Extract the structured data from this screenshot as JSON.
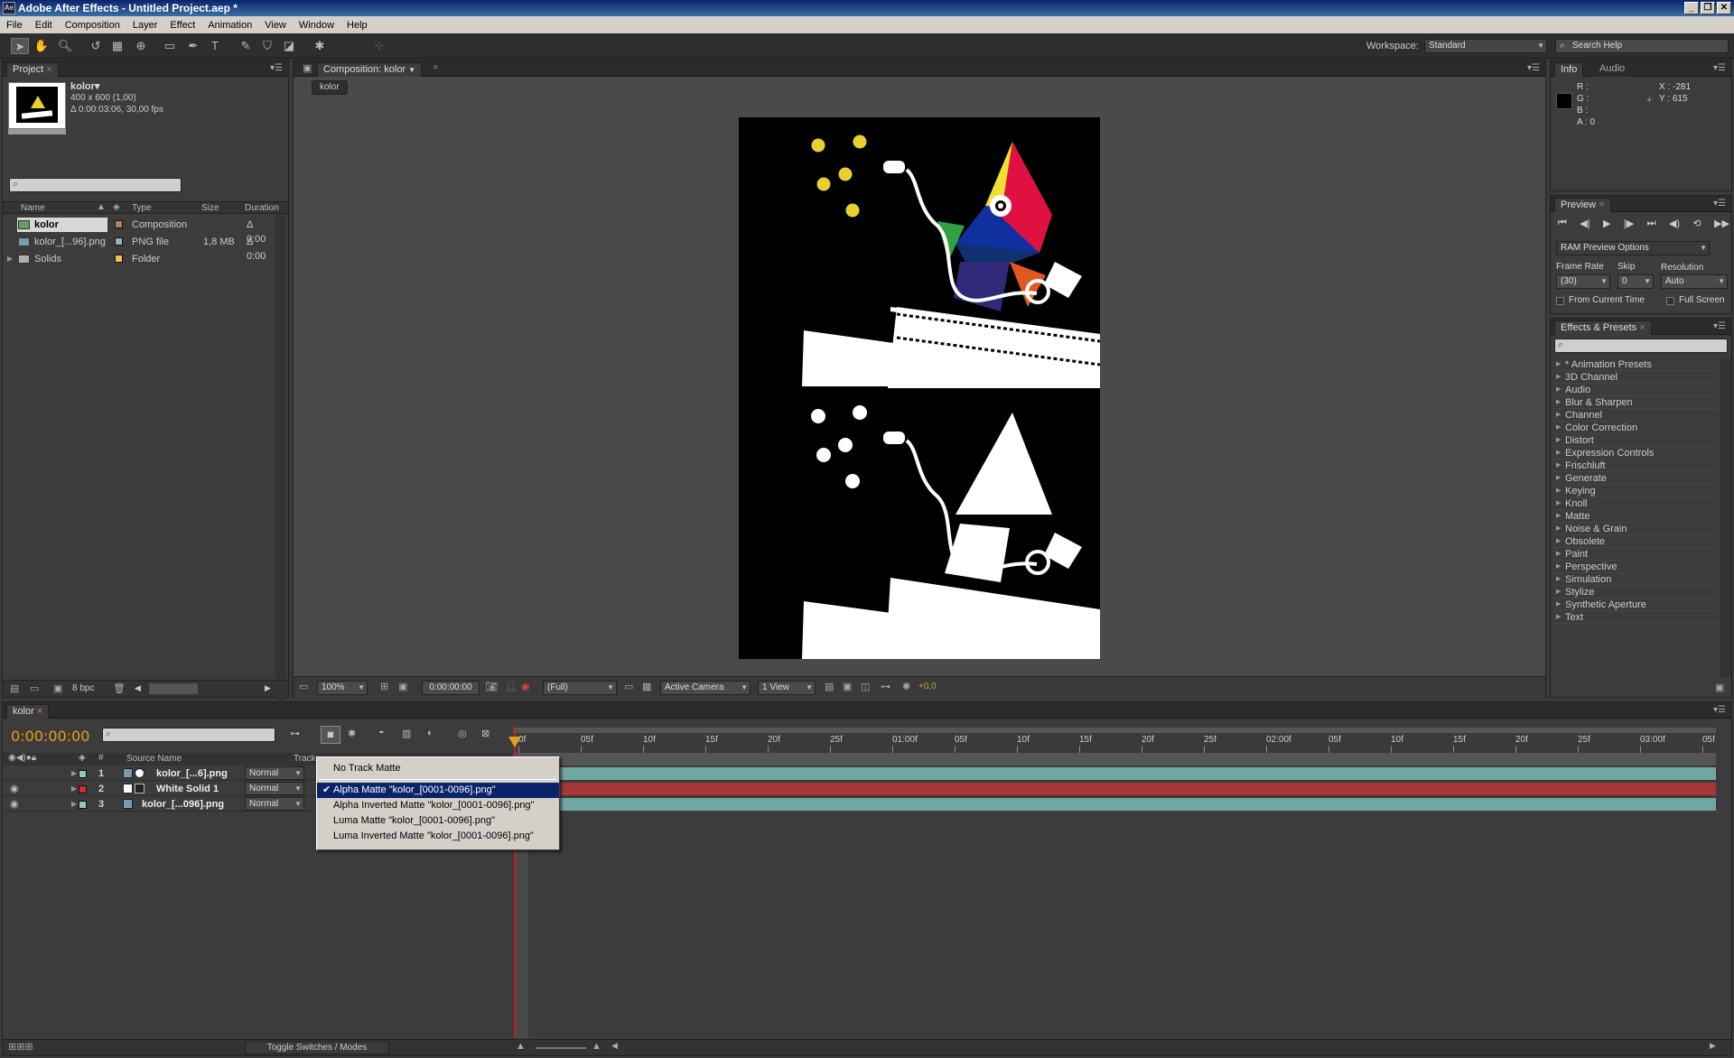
{
  "window": {
    "title": "Adobe After Effects - Untitled Project.aep *",
    "app_badge": "Ae",
    "controls": [
      "_",
      "❐",
      "✕"
    ]
  },
  "menu": [
    "File",
    "Edit",
    "Composition",
    "Layer",
    "Effect",
    "Animation",
    "View",
    "Window",
    "Help"
  ],
  "toolbar": {
    "workspace_label": "Workspace:",
    "workspace_value": "Standard",
    "search_help": "Search Help"
  },
  "project": {
    "tab": "Project",
    "comp_name": "kolor▾",
    "comp_size": "400 x 600 (1,00)",
    "comp_duration": "Δ 0:00:03:06, 30,00 fps",
    "columns": {
      "name": "Name",
      "type": "Type",
      "size": "Size",
      "duration": "Duration"
    },
    "items": [
      {
        "name": "kolor",
        "type": "Composition",
        "size": "",
        "duration": "Δ 0:00",
        "color": "#b08060"
      },
      {
        "name": "kolor_[...96].png",
        "type": "PNG file",
        "size": "1,8 MB",
        "duration": "Δ 0:00",
        "color": "#8fb8b0"
      },
      {
        "name": "Solids",
        "type": "Folder",
        "size": "",
        "duration": "",
        "color": "#e8c84a"
      }
    ],
    "bpc": "8 bpc"
  },
  "composition": {
    "tab": "Composition: kolor",
    "breadcrumb": "kolor",
    "zoom": "100%",
    "timecode": "0:00:00:00",
    "resolution": "(Full)",
    "camera": "Active Camera",
    "views": "1 View",
    "exposure": "+0,0"
  },
  "info": {
    "tabs": [
      "Info",
      "Audio"
    ],
    "r": "R :",
    "g": "G :",
    "b": "B :",
    "a": "A : 0",
    "x": "X : -281",
    "y": "Y : 615"
  },
  "preview": {
    "tab": "Preview",
    "ram_options": "RAM Preview Options",
    "frame_rate_label": "Frame Rate",
    "skip_label": "Skip",
    "resolution_label": "Resolution",
    "frame_rate": "(30)",
    "skip": "0",
    "resolution": "Auto",
    "from_current": "From Current Time",
    "full_screen": "Full Screen"
  },
  "effects": {
    "tab": "Effects & Presets",
    "items": [
      "* Animation Presets",
      "3D Channel",
      "Audio",
      "Blur & Sharpen",
      "Channel",
      "Color Correction",
      "Distort",
      "Expression Controls",
      "Frischluft",
      "Generate",
      "Keying",
      "Knoll",
      "Matte",
      "Noise & Grain",
      "Obsolete",
      "Paint",
      "Perspective",
      "Simulation",
      "Stylize",
      "Synthetic Aperture",
      "Text"
    ]
  },
  "timeline": {
    "tab": "kolor",
    "timecode": "0:00:00:00",
    "col_source": "Source Name",
    "col_track": "Track",
    "toggle": "Toggle Switches / Modes",
    "ruler": [
      "0f",
      "05f",
      "10f",
      "15f",
      "20f",
      "25f",
      "01:00f",
      "05f",
      "10f",
      "15f",
      "20f",
      "25f",
      "02:00f",
      "05f",
      "10f",
      "15f",
      "20f",
      "25f",
      "03:00f",
      "05f"
    ],
    "layers": [
      {
        "num": "1",
        "name": "kolor_[...6].png",
        "mode": "Normal",
        "label": "#8fc8c0",
        "bar": "#6fa8a0"
      },
      {
        "num": "2",
        "name": "White Solid 1",
        "mode": "Normal",
        "label": "#c83030",
        "bar": "#a83838"
      },
      {
        "num": "3",
        "name": "kolor_[...096].png",
        "mode": "Normal",
        "label": "#8fc8c0",
        "bar": "#6fa8a0"
      }
    ]
  },
  "track_matte_menu": {
    "none": "No Track Matte",
    "items": [
      "Alpha Matte \"kolor_[0001-0096].png\"",
      "Alpha Inverted Matte \"kolor_[0001-0096].png\"",
      "Luma Matte \"kolor_[0001-0096].png\"",
      "Luma Inverted Matte \"kolor_[0001-0096].png\""
    ],
    "selected_index": 0
  }
}
